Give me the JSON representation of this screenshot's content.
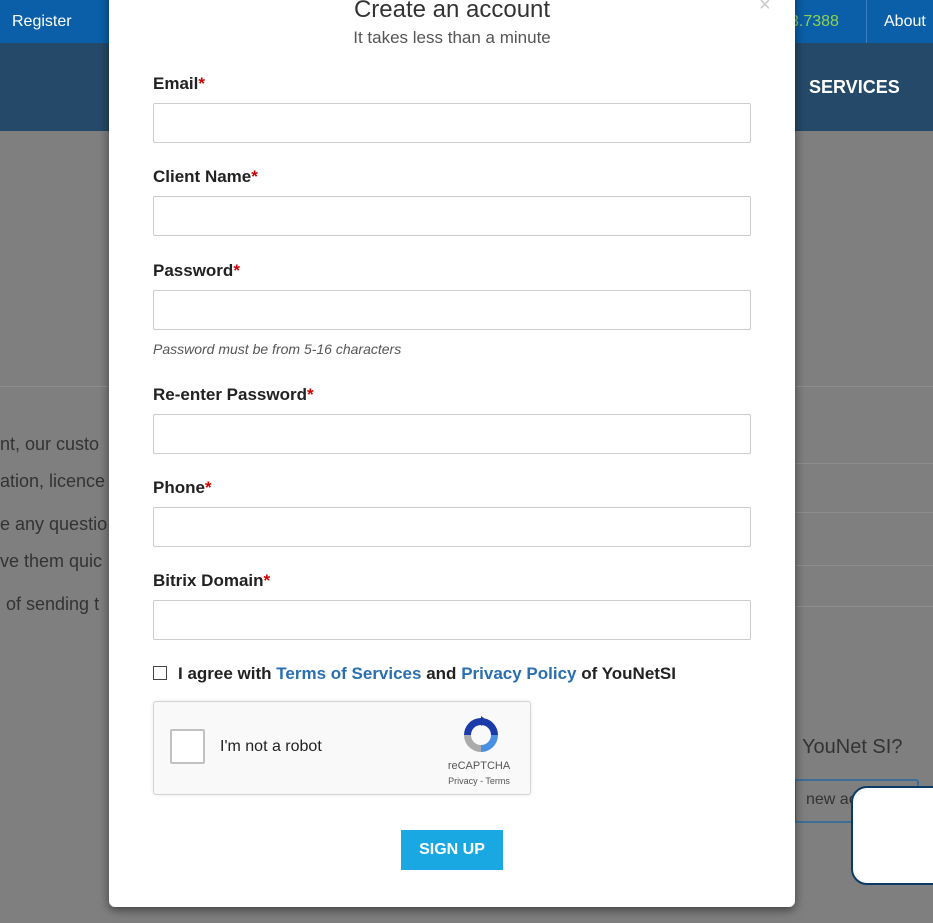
{
  "topbar": {
    "register": "Register",
    "phone": "3.7388",
    "about": "About"
  },
  "navbar": {
    "services": "SERVICES"
  },
  "background": {
    "lines": [
      "nt, our custo",
      "ation, licence",
      "e any questio",
      "ve them quic",
      "of sending t"
    ],
    "question": "YouNet SI?",
    "button_label": "new ac"
  },
  "modal": {
    "close": "×",
    "title": "Create an account",
    "subtitle": "It takes less than a minute",
    "fields": [
      {
        "label": "Email",
        "value": "",
        "placeholder": ""
      },
      {
        "label": "Client Name",
        "value": "",
        "placeholder": ""
      },
      {
        "label": "Password",
        "value": "",
        "placeholder": ""
      },
      {
        "label": "Re-enter Password",
        "value": "",
        "placeholder": ""
      },
      {
        "label": "Phone",
        "value": "",
        "placeholder": ""
      },
      {
        "label": "Bitrix Domain",
        "value": "",
        "placeholder": ""
      }
    ],
    "required_mark": "*",
    "password_hint": "Password must be from 5-16 characters",
    "agree": {
      "prefix": "I agree with",
      "terms": "Terms of Services",
      "and": "and",
      "privacy": "Privacy Policy",
      "suffix": "of YouNetSI"
    },
    "recaptcha": {
      "label": "I'm not a robot",
      "brand": "reCAPTCHA",
      "links": "Privacy - Terms"
    },
    "signup_label": "SIGN UP"
  },
  "colors": {
    "primary": "#0a5fa8",
    "nav": "#254a69",
    "accent": "#1aa8e3",
    "link": "#2a6fb0",
    "required": "#cc0000"
  }
}
